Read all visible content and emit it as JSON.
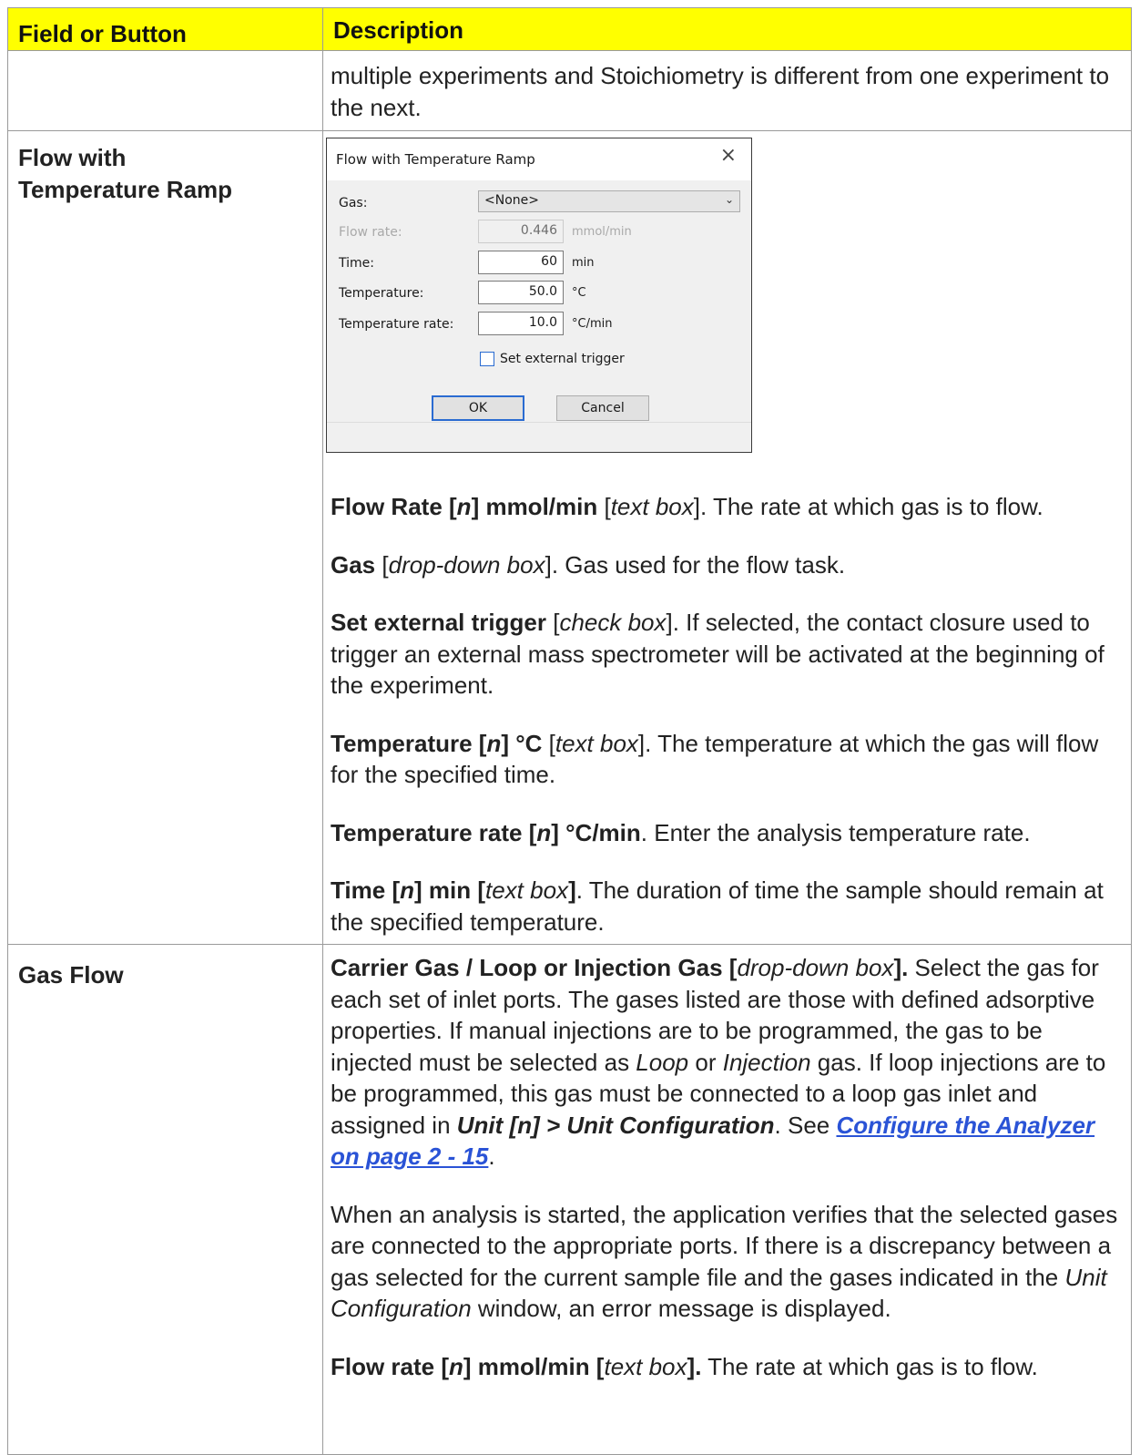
{
  "header": {
    "col1": "Field or Button",
    "col2": "Description"
  },
  "rows": {
    "continuation": {
      "text": "multiple experiments and Stoichiometry is different from one experiment to the next."
    },
    "flow_temp_ramp": {
      "name_line1": "Flow with",
      "name_line2": "Temperature Ramp",
      "dialog": {
        "title": "Flow with Temperature Ramp",
        "gas_label": "Gas:",
        "gas_value": "<None>",
        "flow_rate_label": "Flow rate:",
        "flow_rate_value": "0.446",
        "flow_rate_unit": "mmol/min",
        "time_label": "Time:",
        "time_value": "60",
        "time_unit": "min",
        "temperature_label": "Temperature:",
        "temperature_value": "50.0",
        "temperature_unit": "°C",
        "temp_rate_label": "Temperature rate:",
        "temp_rate_value": "10.0",
        "temp_rate_unit": "°C/min",
        "trigger_label": "Set external trigger",
        "trigger_checked": false,
        "ok_label": "OK",
        "cancel_label": "Cancel"
      },
      "p1": {
        "a": "Flow Rate [",
        "n": "n",
        "b": "] mmol/min",
        "c": " [",
        "d": "text box",
        "e": "]. The rate at which gas is to flow."
      },
      "p2": {
        "a": "Gas",
        "b": " [",
        "c": "drop-down box",
        "d": "]. Gas used for the flow task."
      },
      "p3": {
        "a": "Set external trigger",
        "b": " [",
        "c": "check box",
        "d": "]. If selected, the contact closure used to trigger an external mass spectrometer will be activated at the beginning of the experiment."
      },
      "p4": {
        "a": "Temperature [",
        "n": "n",
        "b": "] °C",
        "c": " [",
        "d": "text box",
        "e": "]. The temperature at which the gas will flow for the specified time."
      },
      "p5": {
        "a": "Temperature rate [",
        "n": "n",
        "b": "] °C/min",
        "c": ". Enter the analysis temperature rate."
      },
      "p6": {
        "a": "Time [",
        "n": "n",
        "b": "] min [",
        "c": "text box",
        "d": "]",
        "e": ". The duration of time the sample should remain at the specified temperature."
      }
    },
    "gas_flow": {
      "name": "Gas Flow",
      "p1": {
        "a": "Carrier Gas / Loop or Injection Gas [",
        "b": "drop-down box",
        "c": "].",
        "d": " Select the gas for each set of inlet ports. The gases listed are those with defined adsorptive properties. If manual injections are to be programmed, the gas to be injected must be selected as ",
        "e": "Loop",
        "f": " or ",
        "g": "Injection",
        "h": " gas. If loop injections are to be programmed, this gas must be connected to a loop gas inlet and assigned in ",
        "i": "Unit [n] > Unit Configuration",
        "j": ". See ",
        "link": "Configure the Analyzer on page 2 - 15",
        "k": "."
      },
      "p2": {
        "a": "When an analysis is started, the application verifies that the selected gases are connected to the appropriate ports. If there is a discrepancy between a gas selected for the current sample file and the gases indicated in the ",
        "b": "Unit Configuration",
        "c": " window, an error message is displayed."
      },
      "p3": {
        "a": "Flow rate [",
        "n": "n",
        "b": "] mmol/min [",
        "c": "text box",
        "d": "].",
        "e": " The rate at which gas is to flow."
      }
    }
  }
}
